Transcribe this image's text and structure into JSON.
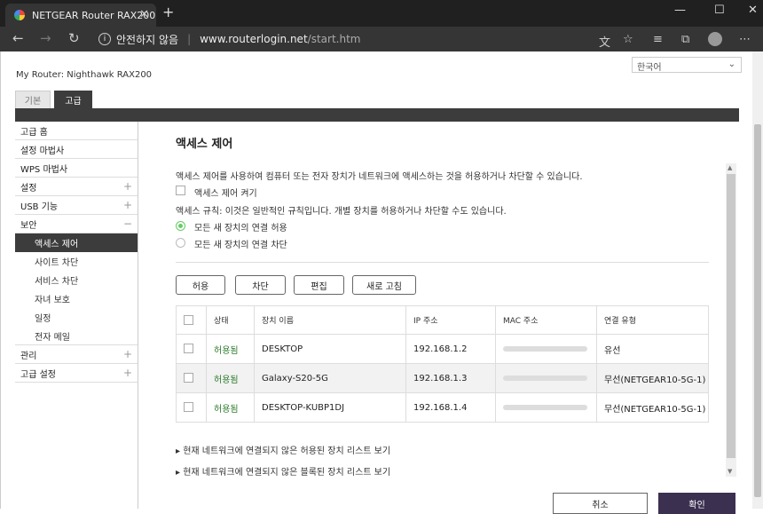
{
  "browser": {
    "tab_title": "NETGEAR Router RAX200",
    "security_label": "안전하지 않음",
    "url_host": "www.routerlogin.net",
    "url_path": "/start.htm"
  },
  "header": {
    "router_label": "My Router: Nighthawk RAX200",
    "language": "한국어",
    "tabs": {
      "basic": "기본",
      "advanced": "고급"
    }
  },
  "sidebar": {
    "items": [
      {
        "label": "고급 홈",
        "pm": ""
      },
      {
        "label": "설정 마법사",
        "pm": ""
      },
      {
        "label": "WPS 마법사",
        "pm": ""
      },
      {
        "label": "설정",
        "pm": "+"
      },
      {
        "label": "USB 기능",
        "pm": "+"
      },
      {
        "label": "보안",
        "pm": "−"
      }
    ],
    "sub_items": [
      "액세스 제어",
      "사이트 차단",
      "서비스 차단",
      "자녀 보호",
      "일정",
      "전자 메일"
    ],
    "bottom_items": [
      {
        "label": "관리",
        "pm": "+"
      },
      {
        "label": "고급 설정",
        "pm": "+"
      }
    ]
  },
  "content": {
    "title": "액세스 제어",
    "description": "액세스 제어를 사용하여 컴퓨터 또는 전자 장치가 네트워크에 액세스하는 것을 허용하거나 차단할 수 있습니다.",
    "enable_label": "액세스 제어 켜기",
    "rule_text": "액세스 규칙: 이것은 일반적인 규칙입니다. 개별 장치를 허용하거나 차단할 수도 있습니다.",
    "radio_allow": "모든 새 장치의 연결 허용",
    "radio_block": "모든 새 장치의 연결 차단",
    "buttons": {
      "allow": "허용",
      "block": "차단",
      "edit": "편집",
      "refresh": "새로 고침"
    },
    "table": {
      "headers": [
        "상태",
        "장치 이름",
        "IP 주소",
        "MAC 주소",
        "연결 유형"
      ],
      "rows": [
        {
          "status": "허용됨",
          "name": "DESKTOP",
          "ip": "192.168.1.2",
          "type": "유선"
        },
        {
          "status": "허용됨",
          "name": "Galaxy-S20-5G",
          "ip": "192.168.1.3",
          "type": "무선(NETGEAR10-5G-1)"
        },
        {
          "status": "허용됨",
          "name": "DESKTOP-KUBP1DJ",
          "ip": "192.168.1.4",
          "type": "무선(NETGEAR10-5G-1)"
        }
      ]
    },
    "link_allowed": "▸ 현재 네트워크에 연결되지 않은 허용된 장치 리스트 보기",
    "link_blocked": "▸ 현재 네트워크에 연결되지 않은 블록된 장치 리스트 보기"
  },
  "footer": {
    "cancel": "취소",
    "apply": "확인"
  }
}
